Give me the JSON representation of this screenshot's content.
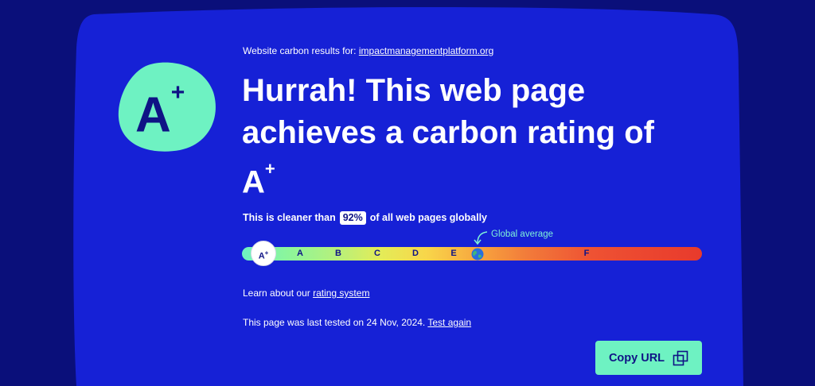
{
  "results": {
    "prefix": "Website carbon results for:",
    "url": "impactmanagementplatform.org"
  },
  "badge": {
    "grade_letter": "A",
    "grade_mod": "+"
  },
  "headline": {
    "line1": "Hurrah! This web page",
    "line2": "achieves a carbon rating of",
    "grade_letter": "A",
    "grade_mod": "+"
  },
  "cleaner": {
    "before": "This is cleaner than",
    "percent": "92%",
    "after": "of all web pages globally"
  },
  "scale": {
    "current": {
      "letter": "A",
      "mod": "+"
    },
    "grades": [
      "A",
      "B",
      "C",
      "D",
      "E",
      "F"
    ],
    "global_average_label": "Global average"
  },
  "learn": {
    "text": "Learn about our",
    "link": "rating system"
  },
  "tested": {
    "text": "This page was last tested on 24 Nov, 2024.",
    "link": "Test again"
  },
  "copy_button": {
    "label": "Copy URL"
  },
  "colors": {
    "background": "#0a0f7a",
    "card": "#1621d6",
    "accent": "#6ef2c2",
    "text_dark": "#0f1385"
  }
}
